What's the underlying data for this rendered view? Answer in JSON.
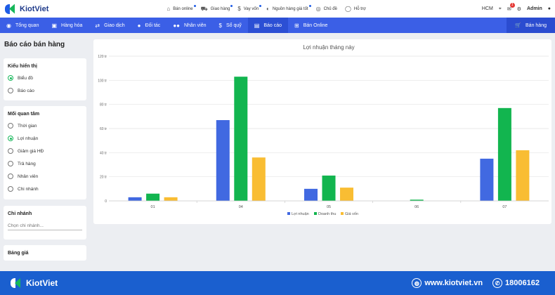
{
  "brand": {
    "name": "KiotViet"
  },
  "top_menu": [
    {
      "icon": "shop-icon",
      "glyph": "⌂",
      "label": "Bán online",
      "dot": true
    },
    {
      "icon": "truck-icon",
      "glyph": "⛟",
      "label": "Giao hàng",
      "dot": true
    },
    {
      "icon": "money-bag-icon",
      "glyph": "$",
      "label": "Vay vốn",
      "dot": true
    },
    {
      "icon": "supplier-icon",
      "glyph": "◐",
      "label": "Nguồn hàng giá tốt",
      "dot": true
    },
    {
      "icon": "palette-icon",
      "glyph": "◎",
      "label": "Chủ đề",
      "dot": false
    },
    {
      "icon": "chat-icon",
      "glyph": "◯",
      "label": "Hỗ trợ",
      "dot": false
    }
  ],
  "top_right": {
    "region": "HCM",
    "notifications": "1",
    "user": "Admin"
  },
  "nav": [
    {
      "label": "Tổng quan",
      "glyph": "◉"
    },
    {
      "label": "Hàng hóa",
      "glyph": "▣"
    },
    {
      "label": "Giao dịch",
      "glyph": "⇄"
    },
    {
      "label": "Đối tác",
      "glyph": "●"
    },
    {
      "label": "Nhân viên",
      "glyph": "●●"
    },
    {
      "label": "Sổ quỹ",
      "glyph": "$"
    },
    {
      "label": "Báo cáo",
      "glyph": "▤"
    },
    {
      "label": "Bán Online",
      "glyph": "⊞"
    }
  ],
  "nav_active": "Báo cáo",
  "nav_sell": "Bán hàng",
  "sidebar": {
    "title": "Báo cáo bán hàng",
    "display_type": {
      "heading": "Kiểu hiển thị",
      "options": [
        "Biểu đồ",
        "Báo cáo"
      ],
      "selected": 0
    },
    "concern": {
      "heading": "Mối quan tâm",
      "options": [
        "Thời gian",
        "Lợi nhuận",
        "Giảm giá HĐ",
        "Trả hàng",
        "Nhân viên",
        "Chi nhánh"
      ],
      "selected": 1
    },
    "branch": {
      "heading": "Chi nhánh",
      "placeholder": "Chọn chi nhánh..."
    },
    "price_table": {
      "heading": "Bảng giá"
    }
  },
  "chart_data": {
    "type": "bar",
    "title": "Lợi nhuận tháng này",
    "categories": [
      "01",
      "04",
      "05",
      "06",
      "07"
    ],
    "series": [
      {
        "name": "Lợi nhuận",
        "color": "#4169e1",
        "values": [
          3,
          67,
          10,
          0,
          35
        ]
      },
      {
        "name": "Doanh thu",
        "color": "#12b54f",
        "values": [
          6,
          103,
          21,
          1,
          77
        ]
      },
      {
        "name": "Giá vốn",
        "color": "#f9bd33",
        "values": [
          3,
          36,
          11,
          0,
          42
        ]
      }
    ],
    "ylim": [
      0,
      120
    ],
    "yticks": [
      0,
      20,
      40,
      60,
      80,
      100,
      120
    ],
    "ytick_labels": [
      "0",
      "20 tr",
      "40 tr",
      "60 tr",
      "80 tr",
      "100 tr",
      "120 tr"
    ],
    "grid": true,
    "legend": "bottom"
  },
  "footer": {
    "website": "www.kiotviet.vn",
    "hotline": "18006162"
  }
}
